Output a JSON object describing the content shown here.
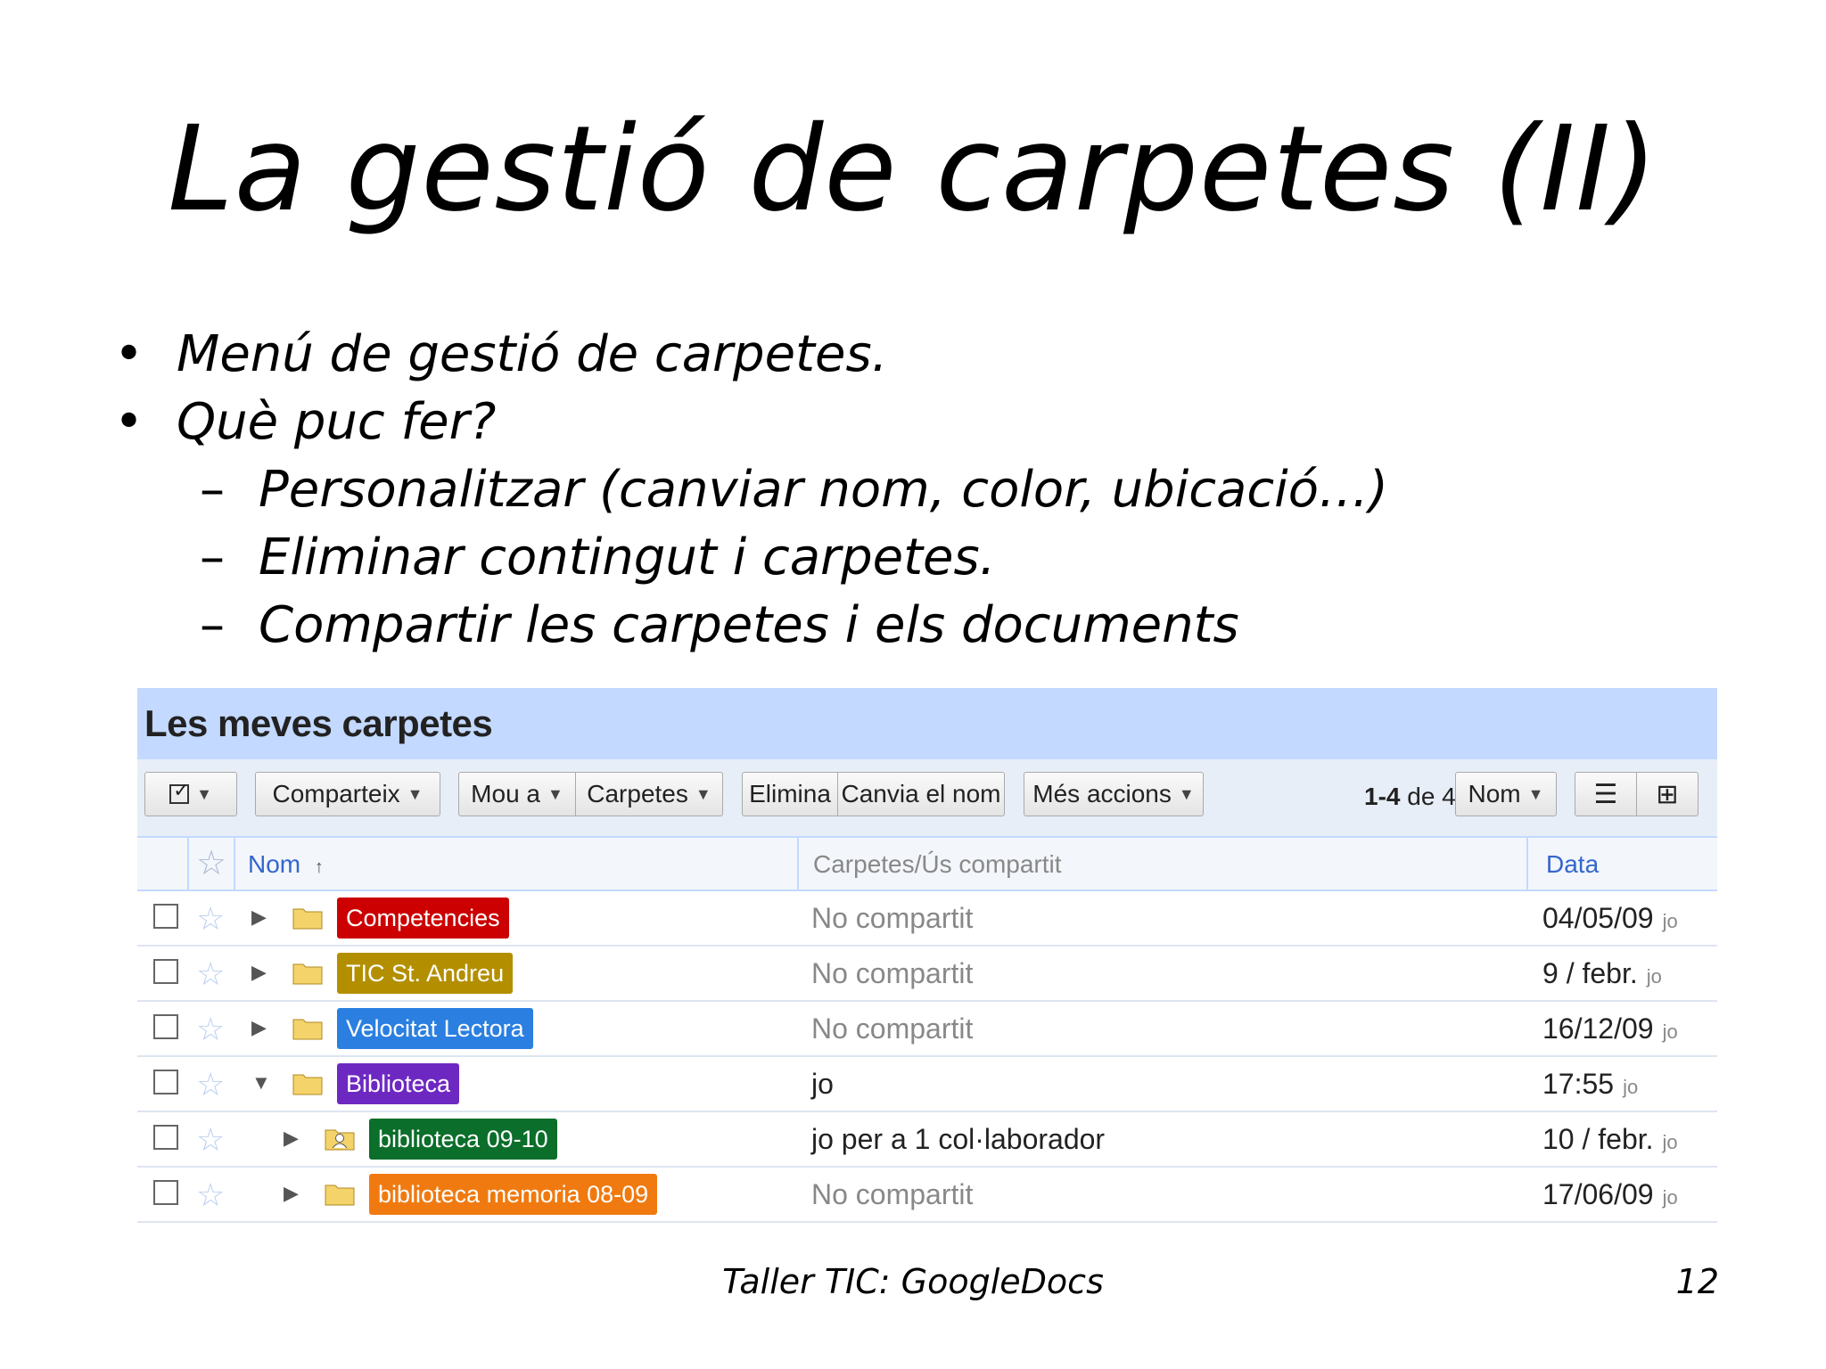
{
  "slide": {
    "title": "La gestió de carpetes (II)",
    "bullets": [
      {
        "mark": "•",
        "text": "Menú de gestió de carpetes.",
        "level": 1
      },
      {
        "mark": "•",
        "text": "Què puc fer?",
        "level": 1
      },
      {
        "mark": "–",
        "text": "Personalitzar (canviar nom, color, ubicació…)",
        "level": 2
      },
      {
        "mark": "–",
        "text": "Eliminar contingut i carpetes.",
        "level": 2
      },
      {
        "mark": "–",
        "text": "Compartir les carpetes i els documents",
        "level": 2
      }
    ],
    "footer": "Taller TIC: GoogleDocs",
    "page_number": "12"
  },
  "screenshot": {
    "header_title": "Les meves carpetes",
    "toolbar": {
      "select_icon": "checkbox-icon",
      "share_label": "Comparteix",
      "move_label": "Mou a",
      "folders_label": "Carpetes",
      "delete_label": "Elimina",
      "rename_label": "Canvia el nom",
      "more_label": "Més accions",
      "pager_range": "1-4",
      "pager_of": "de 4",
      "sort_label": "Nom"
    },
    "columns": {
      "name": "Nom",
      "sharing": "Carpetes/Ús compartit",
      "date": "Data"
    },
    "rows": [
      {
        "name": "Competencies",
        "color": "#cc0000",
        "sharing": "No compartit",
        "date": "04/05/09",
        "who": "jo",
        "expanded": false,
        "indent": 0,
        "shared_folder": false
      },
      {
        "name": "TIC St. Andreu",
        "color": "#b38f00",
        "sharing": "No compartit",
        "date": "9 / febr.",
        "who": "jo",
        "expanded": false,
        "indent": 0,
        "shared_folder": false
      },
      {
        "name": "Velocitat Lectora",
        "color": "#2a7fe0",
        "sharing": "No compartit",
        "date": "16/12/09",
        "who": "jo",
        "expanded": false,
        "indent": 0,
        "shared_folder": false
      },
      {
        "name": "Biblioteca",
        "color": "#6e28c2",
        "sharing": "jo",
        "date": "17:55",
        "who": "jo",
        "expanded": true,
        "indent": 0,
        "shared_folder": false
      },
      {
        "name": "biblioteca 09-10",
        "color": "#0b6e2a",
        "sharing": "jo per a 1 col·laborador",
        "date": "10 / febr.",
        "who": "jo",
        "expanded": false,
        "indent": 1,
        "shared_folder": true
      },
      {
        "name": "biblioteca memoria 08-09",
        "color": "#f07a10",
        "sharing": "No compartit",
        "date": "17/06/09",
        "who": "jo",
        "expanded": false,
        "indent": 1,
        "shared_folder": false
      }
    ]
  }
}
